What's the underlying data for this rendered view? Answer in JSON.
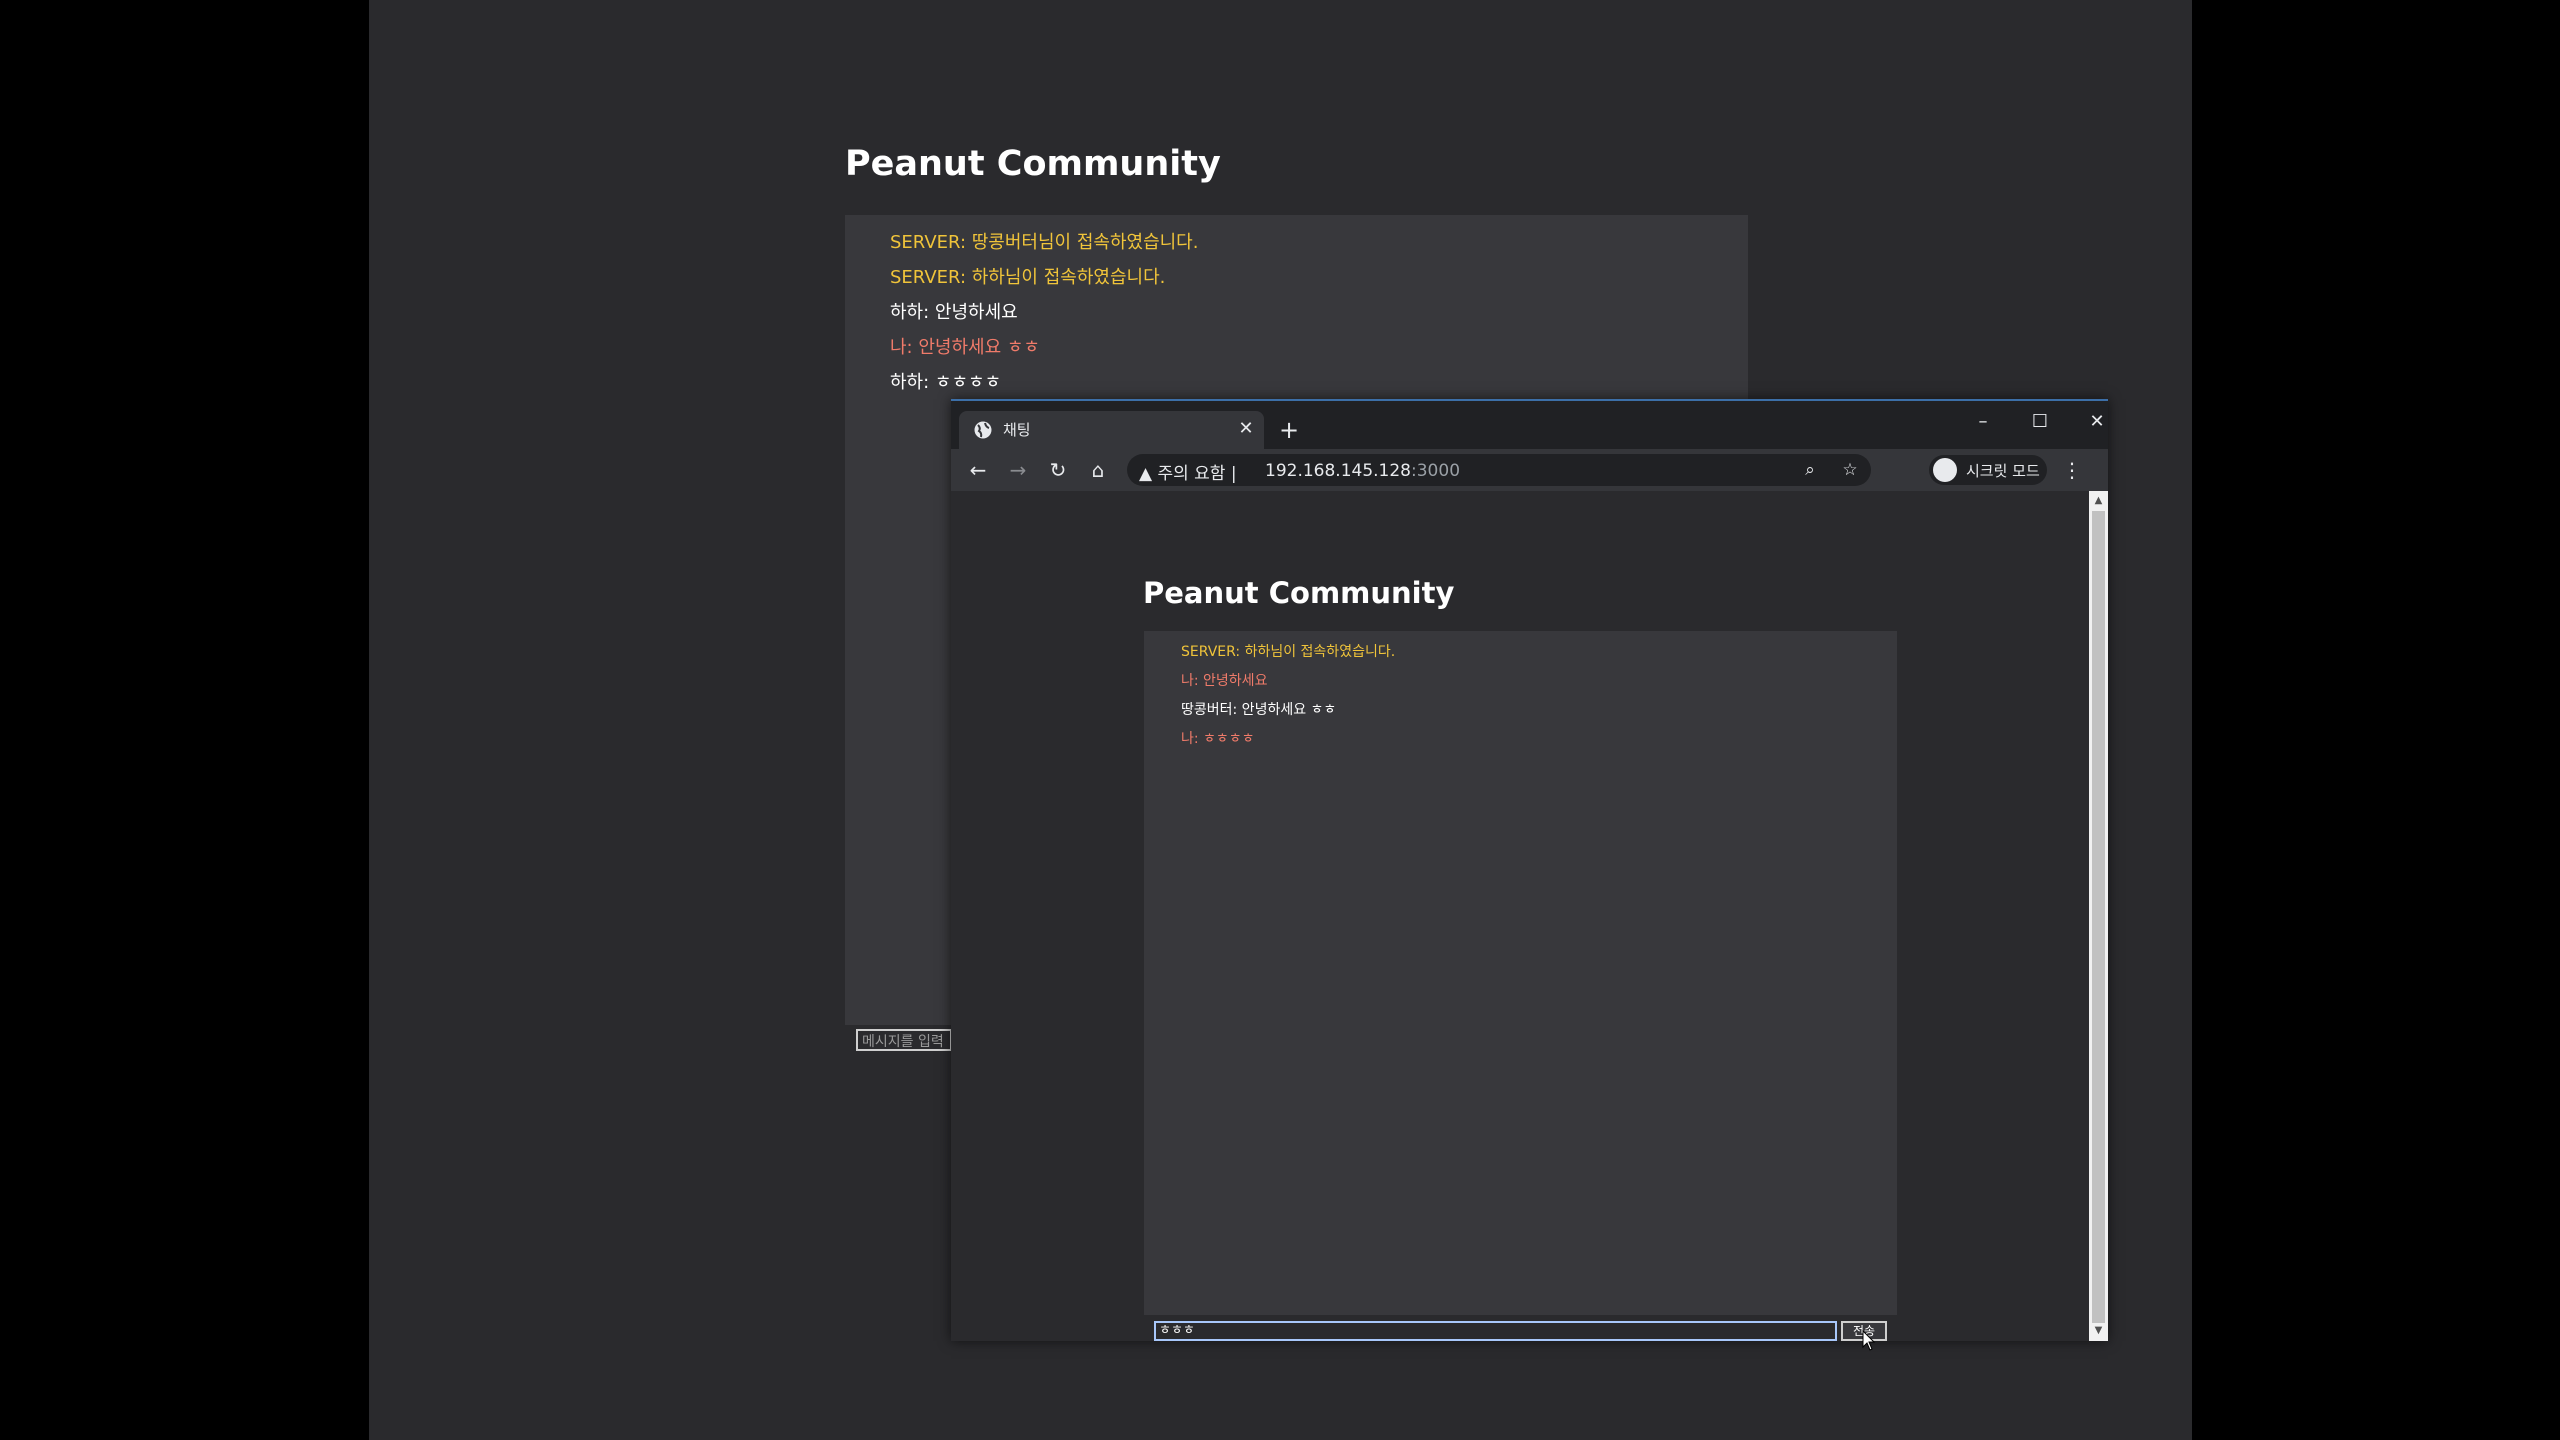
{
  "colors": {
    "server": "#f0c43a",
    "self": "#f07b6a",
    "other": "#ffffff"
  },
  "background_page": {
    "title": "Peanut Community",
    "messages": [
      {
        "text": "SERVER: 땅콩버터님이 접속하였습니다.",
        "type": "server"
      },
      {
        "text": "SERVER: 하하님이 접속하였습니다.",
        "type": "server"
      },
      {
        "text": "하하: 안녕하세요",
        "type": "other"
      },
      {
        "text": "나: 안녕하세요 ㅎㅎ",
        "type": "self"
      },
      {
        "text": "하하: ㅎㅎㅎㅎ",
        "type": "other"
      }
    ],
    "input_placeholder": "메시지를 입력"
  },
  "browser": {
    "tab_title": "채팅",
    "address_warning": "주의 요함",
    "url_host": "192.168.145.128",
    "url_port": ":3000",
    "incognito_label": "시크릿 모드",
    "page": {
      "title": "Peanut Community",
      "messages": [
        {
          "text": "SERVER: 하하님이 접속하였습니다.",
          "type": "server"
        },
        {
          "text": "나: 안녕하세요",
          "type": "self"
        },
        {
          "text": "땅콩버터: 안녕하세요 ㅎㅎ",
          "type": "other"
        },
        {
          "text": "나: ㅎㅎㅎㅎ",
          "type": "self"
        }
      ],
      "input_value": "ㅎㅎㅎ",
      "send_label": "전송"
    }
  }
}
